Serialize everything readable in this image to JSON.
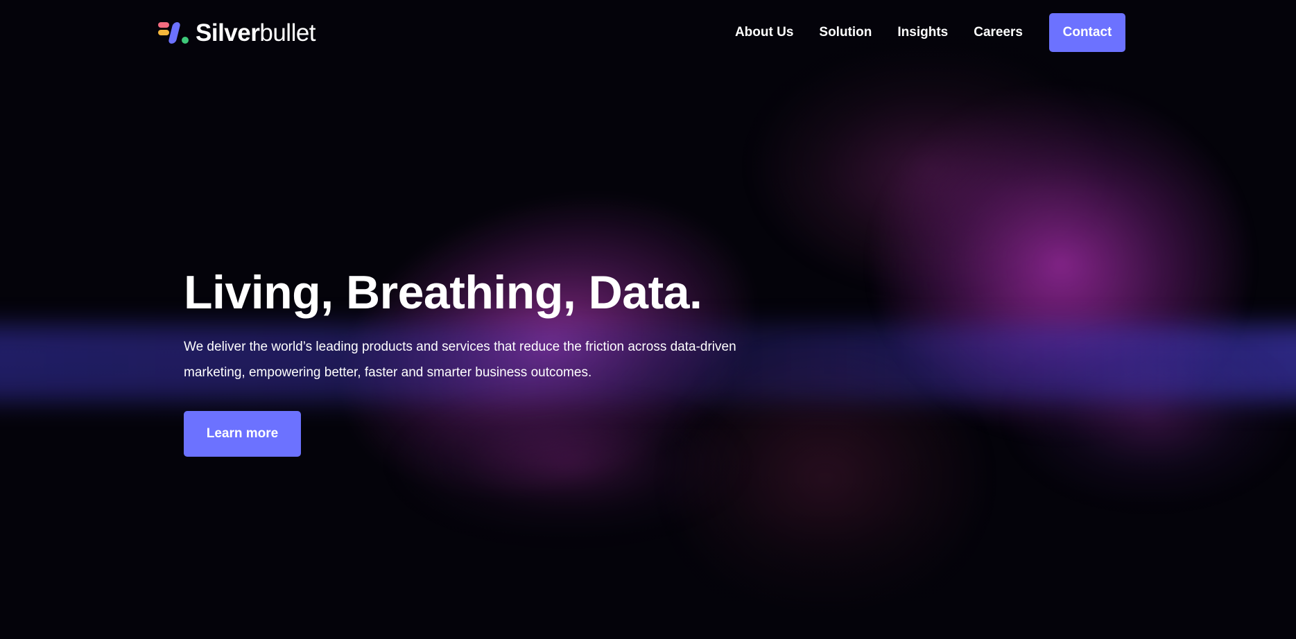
{
  "brand": {
    "name_bold": "Silver",
    "name_light": "bullet",
    "colors": {
      "accent": "#6c72ff",
      "logo_red": "#f36b7f",
      "logo_yellow": "#f6b73c",
      "logo_green": "#3ec97a",
      "background": "#04030a"
    }
  },
  "nav": {
    "items": [
      {
        "label": "About Us"
      },
      {
        "label": "Solution"
      },
      {
        "label": "Insights"
      },
      {
        "label": "Careers"
      }
    ],
    "contact_label": "Contact"
  },
  "hero": {
    "title": "Living, Breathing, Data.",
    "subtitle": "We deliver the world’s leading products and services that reduce the friction across data-driven marketing, empowering better, faster and smarter business outcomes.",
    "cta_label": "Learn more"
  }
}
